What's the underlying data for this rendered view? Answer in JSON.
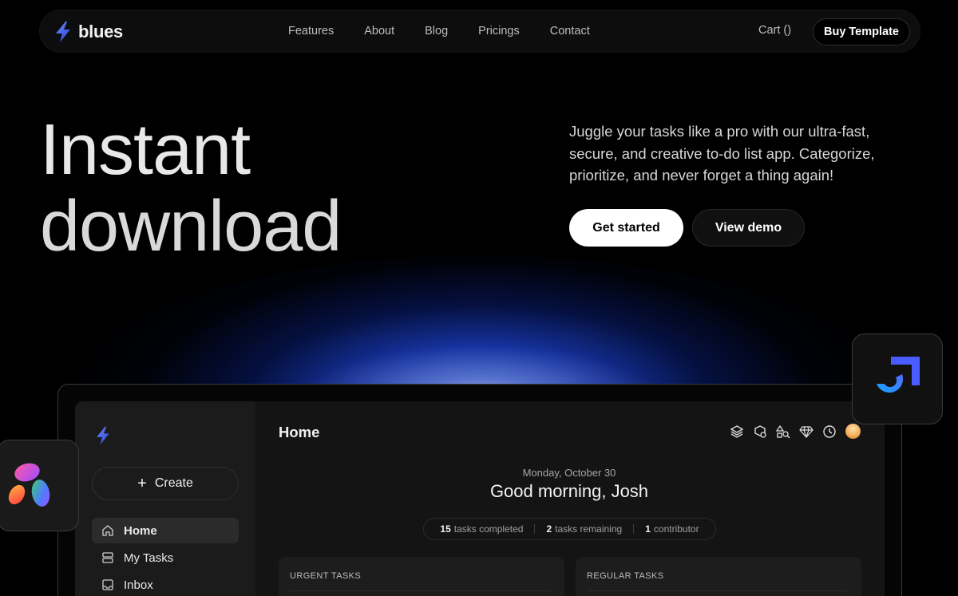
{
  "nav": {
    "brand": "blues",
    "links": [
      "Features",
      "About",
      "Blog",
      "Pricings",
      "Contact"
    ],
    "cart": "Cart ()",
    "cta": "Buy Template"
  },
  "hero": {
    "title_line1": "Instant",
    "title_line2": "download",
    "description": "Juggle your tasks like a pro with our ultra-fast, secure, and creative to-do list app. Categorize, prioritize, and never forget a thing again!",
    "primary_button": "Get started",
    "secondary_button": "View demo"
  },
  "app": {
    "sidebar": {
      "create": "Create",
      "items": [
        {
          "label": "Home",
          "icon": "home-icon",
          "active": true
        },
        {
          "label": "My Tasks",
          "icon": "tasks-icon",
          "active": false
        },
        {
          "label": "Inbox",
          "icon": "inbox-icon",
          "active": false
        }
      ]
    },
    "header": {
      "title": "Home"
    },
    "toolbar_icons": [
      "layers-icon",
      "box-add-icon",
      "shapes-search-icon",
      "diamond-icon",
      "clock-icon",
      "avatar"
    ],
    "date": "Monday, October 30",
    "greeting": "Good morning, Josh",
    "stats": [
      {
        "value": "15",
        "label": "tasks completed"
      },
      {
        "value": "2",
        "label": "tasks remaining"
      },
      {
        "value": "1",
        "label": "contributor"
      }
    ],
    "cards": [
      {
        "title": "URGENT TASKS"
      },
      {
        "title": "REGULAR TASKS"
      }
    ]
  },
  "colors": {
    "accent_blue": "#3b63ff",
    "background": "#000000",
    "glow": "#1e46dc"
  }
}
